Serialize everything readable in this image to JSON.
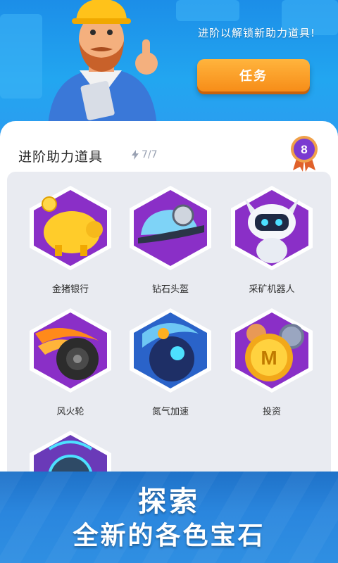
{
  "header": {
    "promo_text": "进阶以解锁新助力道具!",
    "task_button_label": "任务"
  },
  "panel": {
    "title": "进阶助力道具",
    "count": "7/7",
    "level": "8",
    "items": [
      {
        "label": "金猪银行",
        "icon": "gold-piggy-bank-icon"
      },
      {
        "label": "钻石头盔",
        "icon": "diamond-helmet-icon"
      },
      {
        "label": "采矿机器人",
        "icon": "mining-robot-icon"
      },
      {
        "label": "风火轮",
        "icon": "fire-wheel-icon"
      },
      {
        "label": "氮气加速",
        "icon": "nitro-boost-icon"
      },
      {
        "label": "投资",
        "icon": "investment-coin-icon"
      },
      {
        "label": "",
        "icon": "stopwatch-icon"
      }
    ]
  },
  "footer": {
    "title": "探索",
    "subtitle": "全新的各色宝石"
  },
  "colors": {
    "header_blue": "#22a6f0",
    "button_orange": "#f78d18",
    "hex_purple": "#8a2fc7",
    "badge_purple": "#7a3bd1",
    "footer_blue": "#2a86de"
  }
}
